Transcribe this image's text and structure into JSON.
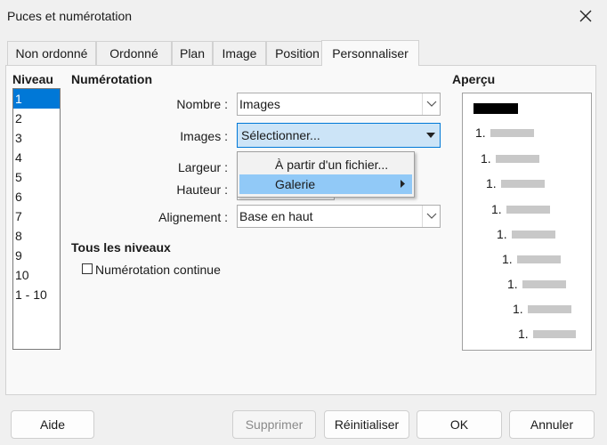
{
  "window": {
    "title": "Puces et numérotation"
  },
  "tabs": [
    {
      "label": "Non ordonné"
    },
    {
      "label": "Ordonné"
    },
    {
      "label": "Plan"
    },
    {
      "label": "Image"
    },
    {
      "label": "Position"
    },
    {
      "label": "Personnaliser"
    }
  ],
  "levels": {
    "heading": "Niveau",
    "items": [
      "1",
      "2",
      "3",
      "4",
      "5",
      "6",
      "7",
      "8",
      "9",
      "10",
      "1 - 10"
    ],
    "selected": "1"
  },
  "numbering": {
    "heading": "Numérotation",
    "nombre_label": "Nombre :",
    "nombre_value": "Images",
    "images_label": "Images :",
    "images_value": "Sélectionner...",
    "largeur_label": "Largeur :",
    "hauteur_label": "Hauteur :",
    "alignement_label": "Alignement :",
    "alignement_value": "Base en haut"
  },
  "all_levels": {
    "heading": "Tous les niveaux",
    "continuous_label": "Numérotation continue",
    "continuous_checked": false
  },
  "popup_menu": {
    "items": [
      {
        "label": "À partir d'un fichier..."
      },
      {
        "label": "Galerie"
      }
    ]
  },
  "preview": {
    "heading": "Aperçu",
    "number_label": "1."
  },
  "buttons": {
    "help": "Aide",
    "delete": "Supprimer",
    "reset": "Réinitialiser",
    "ok": "OK",
    "cancel": "Annuler"
  },
  "colors": {
    "selection": "#0078d7",
    "menu_highlight": "#91c9f7",
    "combo_highlight": "#cce4f7"
  }
}
